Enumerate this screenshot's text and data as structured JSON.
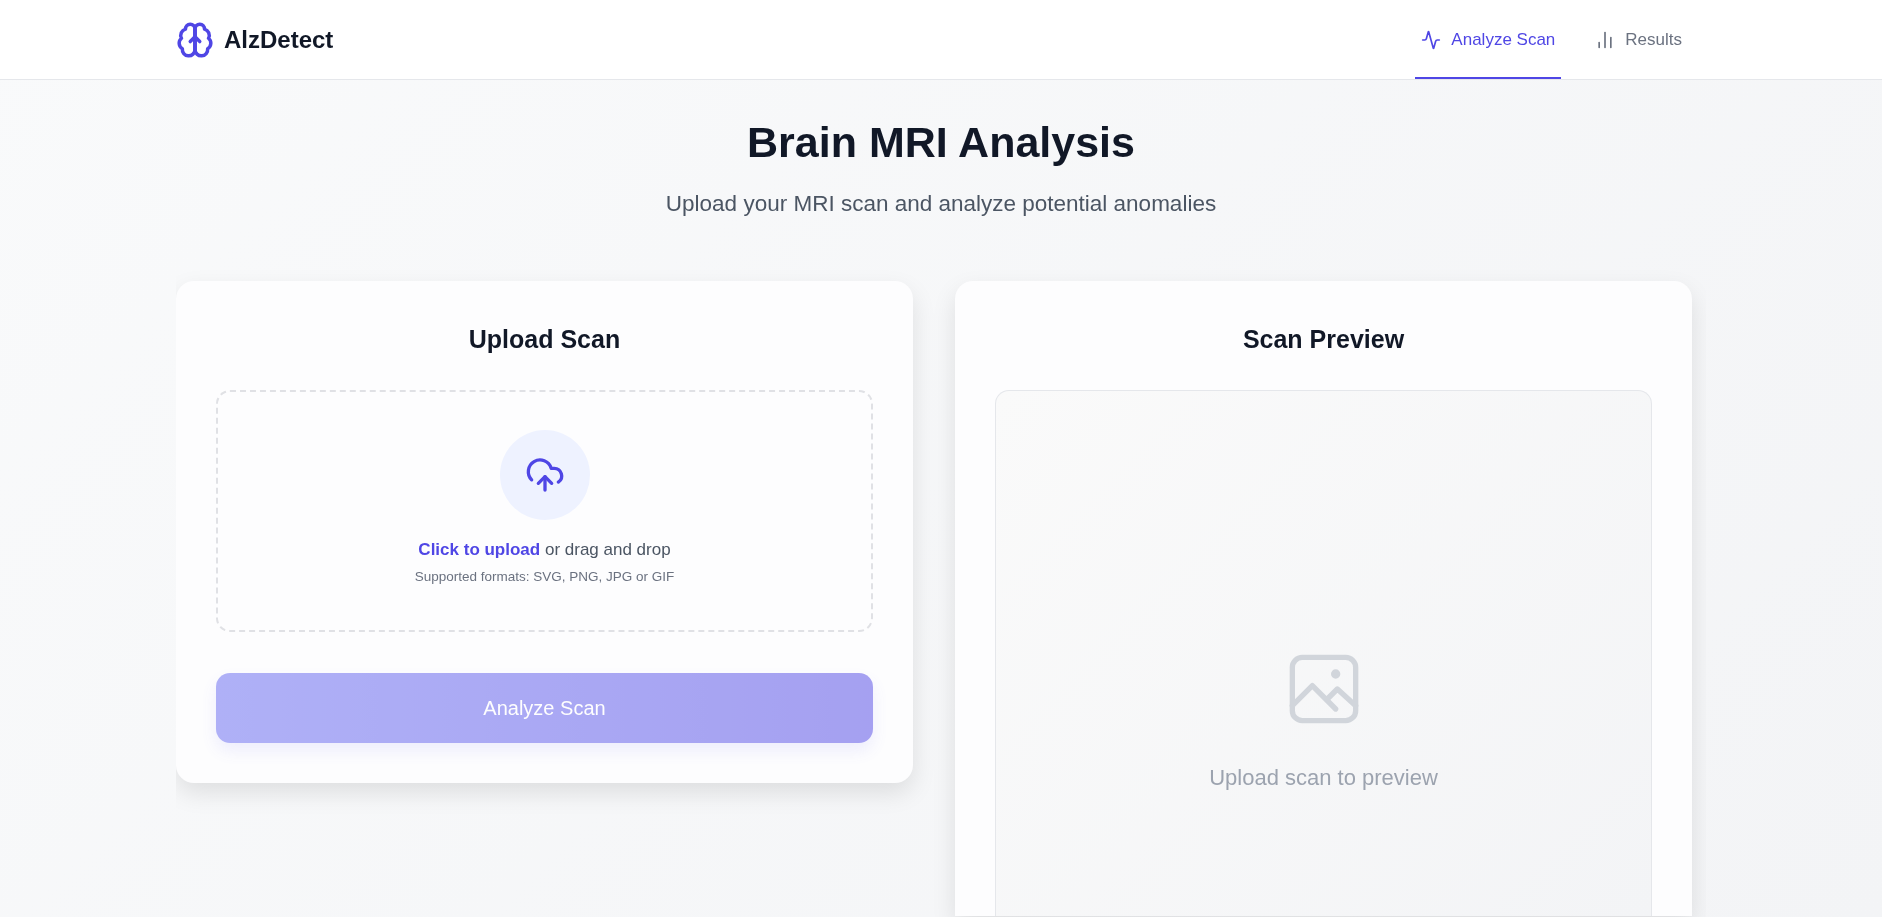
{
  "brand": {
    "name": "AlzDetect"
  },
  "nav": [
    {
      "label": "Analyze Scan",
      "selected": true
    },
    {
      "label": "Results",
      "selected": false
    }
  ],
  "hero": {
    "title": "Brain MRI Analysis",
    "subtitle": "Upload your MRI scan and analyze potential anomalies"
  },
  "upload_card": {
    "title": "Upload Scan",
    "dropzone": {
      "prompt": "**Click to upload** or drag and drop",
      "formats": "Supported formats: SVG, PNG, JPG or GIF"
    },
    "button": {
      "label": "Analyze Scan",
      "disabled": true
    }
  },
  "preview_card": {
    "title": "Scan Preview",
    "empty_text": "Upload scan to preview"
  }
}
